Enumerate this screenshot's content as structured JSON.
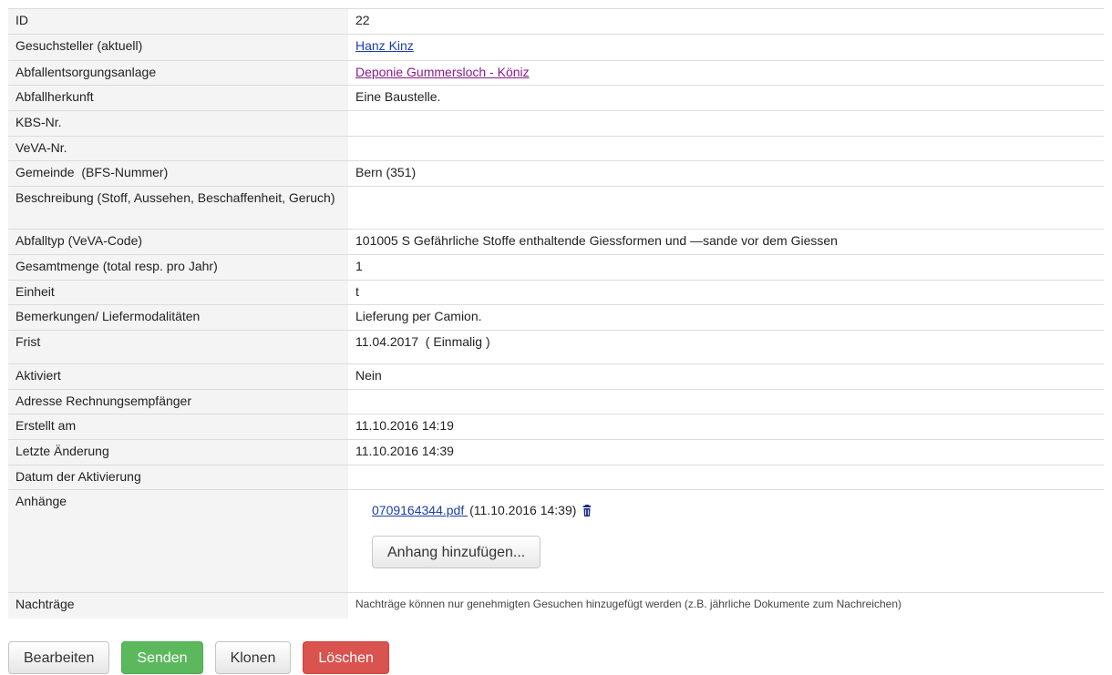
{
  "rows": {
    "id": {
      "label": "ID",
      "value": "22"
    },
    "applicant": {
      "label": "Gesuchsteller (aktuell)",
      "value": "Hanz Kinz"
    },
    "facility": {
      "label": "Abfallentsorgungsanlage",
      "value": "Deponie Gummersloch - Köniz"
    },
    "origin": {
      "label": "Abfallherkunft",
      "value": "Eine Baustelle."
    },
    "kbs": {
      "label": "KBS-Nr.",
      "value": ""
    },
    "veva": {
      "label": "VeVA-Nr.",
      "value": ""
    },
    "municipality": {
      "label": "Gemeinde  (BFS-Nummer)",
      "value": "Bern (351)"
    },
    "description": {
      "label": "Beschreibung (Stoff, Aussehen, Beschaffenheit, Geruch)",
      "value": ""
    },
    "waste_type": {
      "label": "Abfalltyp (VeVA-Code)",
      "value": "101005 S Gefährliche Stoffe enthaltende Giessformen und —sande vor dem Giessen"
    },
    "quantity": {
      "label": "Gesamtmenge (total resp. pro Jahr)",
      "value": "1"
    },
    "unit": {
      "label": "Einheit",
      "value": "t"
    },
    "remarks": {
      "label": "Bemerkungen/ Liefermodalitäten",
      "value": "Lieferung per Camion."
    },
    "deadline": {
      "label": "Frist",
      "value": "11.04.2017  ( Einmalig )"
    },
    "activated": {
      "label": "Aktiviert",
      "value": "Nein"
    },
    "billing_address": {
      "label": "Adresse Rechnungsempfänger",
      "value": ""
    },
    "created": {
      "label": "Erstellt am",
      "value": "11.10.2016 14:19"
    },
    "modified": {
      "label": "Letzte Änderung",
      "value": "11.10.2016 14:39"
    },
    "activation_date": {
      "label": "Datum der Aktivierung",
      "value": ""
    },
    "attachments": {
      "label": "Anhänge",
      "file_name": "0709164344.pdf ",
      "file_date": "(11.10.2016 14:39)",
      "delete_icon": "trash-icon",
      "add_button": "Anhang hinzufügen..."
    },
    "supplements": {
      "label": "Nachträge",
      "value": "Nachträge können nur genehmigten Gesuchen hinzugefügt werden (z.B. jährliche Dokumente zum Nachreichen)"
    }
  },
  "actions": {
    "edit": "Bearbeiten",
    "send": "Senden",
    "clone": "Klonen",
    "delete": "Löschen"
  },
  "colors": {
    "label_bg": "#f4f4f4",
    "link": "#1a3ea8",
    "visited_link": "#8a1a8a",
    "send_button": "#5cb85c",
    "delete_button": "#d9534f"
  }
}
